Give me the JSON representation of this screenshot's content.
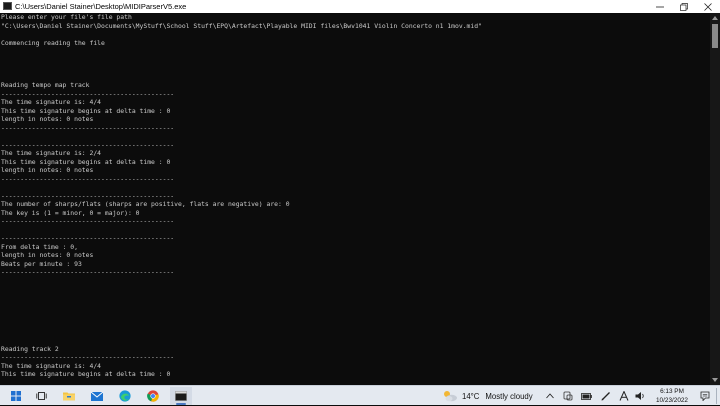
{
  "window": {
    "title": "C:\\Users\\Daniel Stainer\\Desktop\\MIDIParserV5.exe",
    "controls": {
      "minimize": "minimize-icon",
      "maximize": "maximize-icon",
      "close": "close-icon"
    }
  },
  "console": {
    "lines": [
      "Please enter your file's file path",
      "\"C:\\Users\\Daniel Stainer\\Documents\\MyStuff\\School Stuff\\EPQ\\Artefact\\Playable MIDI files\\Bwv1041 Violin Concerto n1 1mov.mid\"",
      "",
      "Commencing reading the file",
      "",
      "",
      "",
      "",
      "Reading tempo map track",
      "---------------------------------------------",
      "The time signature is: 4/4",
      "This time signature begins at delta time : 0",
      "length in notes: 0 notes",
      "---------------------------------------------",
      "",
      "---------------------------------------------",
      "The time signature is: 2/4",
      "This time signature begins at delta time : 0",
      "length in notes: 0 notes",
      "---------------------------------------------",
      "",
      "---------------------------------------------",
      "The number of sharps/flats (sharps are positive, flats are negative) are: 0",
      "The key is (1 = minor, 0 = major): 0",
      "---------------------------------------------",
      "",
      "---------------------------------------------",
      "From delta time : 0,",
      "length in notes: 0 notes",
      "Beats per minute : 93",
      "---------------------------------------------",
      "",
      "",
      "",
      "",
      "",
      "",
      "",
      "",
      "Reading track 2",
      "---------------------------------------------",
      "The time signature is: 4/4",
      "This time signature begins at delta time : 0"
    ]
  },
  "taskbar": {
    "items": [
      {
        "name": "start-button",
        "icon": "windows-logo-icon"
      },
      {
        "name": "task-view-button",
        "icon": "task-view-icon"
      },
      {
        "name": "file-explorer-button",
        "icon": "folder-icon"
      },
      {
        "name": "mail-button",
        "icon": "mail-icon"
      },
      {
        "name": "edge-button",
        "icon": "edge-icon"
      },
      {
        "name": "chrome-button",
        "icon": "chrome-icon"
      },
      {
        "name": "console-app-button",
        "icon": "terminal-icon",
        "active": true
      }
    ],
    "weather": {
      "temperature": "14°C",
      "condition": "Mostly cloudy"
    },
    "clock": {
      "time": "6:13 PM",
      "date": "10/23/2022"
    }
  },
  "colors": {
    "console_bg": "#0c0c0c",
    "console_text": "#cccccc",
    "titlebar_bg": "#ffffff",
    "taskbar_bg": "#e4e9f0",
    "accent": "#4a78c2"
  }
}
